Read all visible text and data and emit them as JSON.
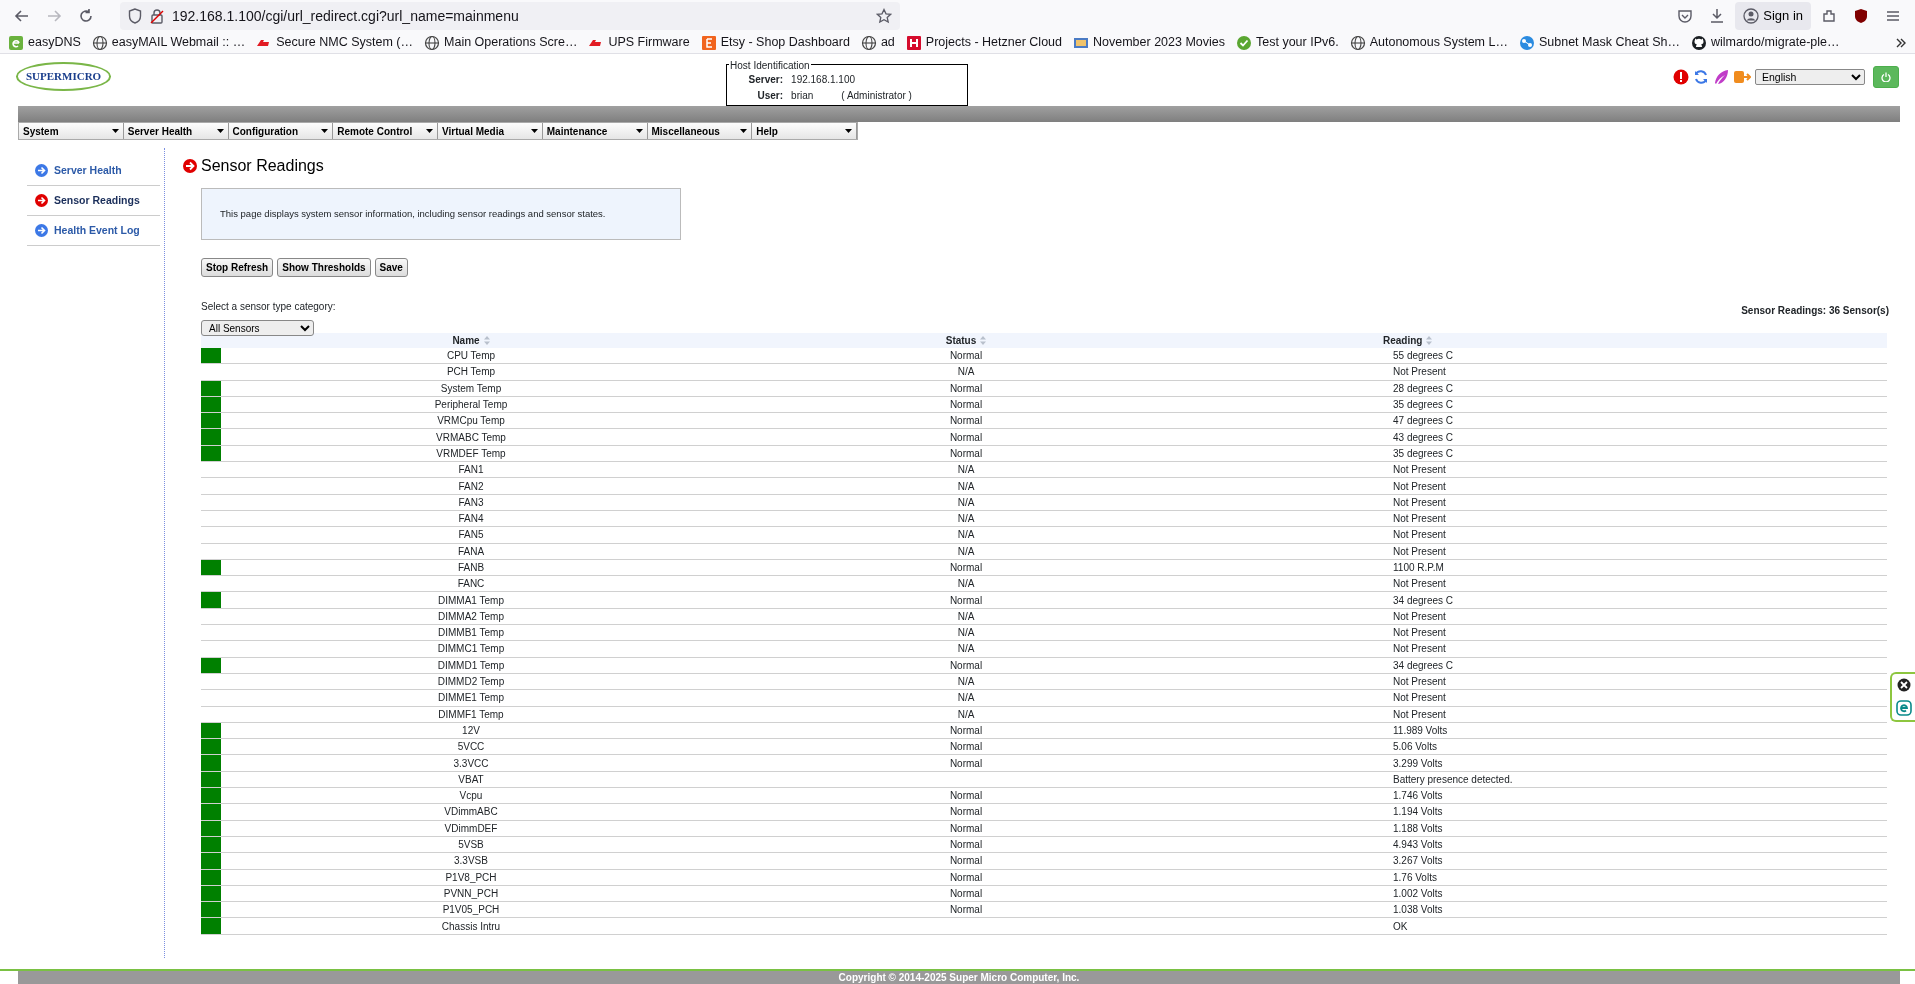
{
  "browser": {
    "url": "192.168.1.100/cgi/url_redirect.cgi?url_name=mainmenu",
    "sign_in": "Sign in",
    "bookmarks": [
      {
        "kind": "easydns",
        "label": "easyDNS"
      },
      {
        "kind": "globe",
        "label": "easyMAIL Webmail :: …"
      },
      {
        "kind": "apc",
        "label": "Secure NMC System (…"
      },
      {
        "kind": "globe",
        "label": "Main Operations Scre…"
      },
      {
        "kind": "apc",
        "label": "UPS Firmware"
      },
      {
        "kind": "etsy",
        "label": "Etsy - Shop Dashboard"
      },
      {
        "kind": "globe",
        "label": "ad"
      },
      {
        "kind": "hetzner",
        "label": "Projects - Hetzner Cloud"
      },
      {
        "kind": "film",
        "label": "November 2023 Movies"
      },
      {
        "kind": "check",
        "label": "Test your IPv6."
      },
      {
        "kind": "globe",
        "label": "Autonomous System L…"
      },
      {
        "kind": "subnet",
        "label": "Subnet Mask Cheat Sh…"
      },
      {
        "kind": "github",
        "label": "wilmardo/migrate-ple…"
      }
    ]
  },
  "header": {
    "logo": "SUPERMICRO",
    "host_legend": "Host Identification",
    "server_label": "Server:",
    "server": "192.168.1.100",
    "user_label": "User:",
    "user": "brian",
    "role": "( Administrator )",
    "language": "English"
  },
  "menu": [
    "System",
    "Server Health",
    "Configuration",
    "Remote Control",
    "Virtual Media",
    "Maintenance",
    "Miscellaneous",
    "Help"
  ],
  "sidebar": {
    "items": [
      {
        "label": "Server Health",
        "selected": false
      },
      {
        "label": "Sensor Readings",
        "selected": true
      },
      {
        "label": "Health Event Log",
        "selected": false
      }
    ]
  },
  "page": {
    "title": "Sensor Readings",
    "intro": "This page displays system sensor information, including sensor readings and sensor states.",
    "buttons": [
      "Stop Refresh",
      "Show Thresholds",
      "Save"
    ],
    "category_label": "Select a sensor type category:",
    "category": "All Sensors",
    "count": "Sensor Readings: 36 Sensor(s)"
  },
  "table": {
    "columns": [
      "Name",
      "Status",
      "Reading"
    ],
    "rows": [
      {
        "name": "CPU Temp",
        "status": "Normal",
        "reading": "55 degrees C",
        "lit": true
      },
      {
        "name": "PCH Temp",
        "status": "N/A",
        "reading": "Not Present",
        "lit": false
      },
      {
        "name": "System Temp",
        "status": "Normal",
        "reading": "28 degrees C",
        "lit": true
      },
      {
        "name": "Peripheral Temp",
        "status": "Normal",
        "reading": "35 degrees C",
        "lit": true
      },
      {
        "name": "VRMCpu Temp",
        "status": "Normal",
        "reading": "47 degrees C",
        "lit": true
      },
      {
        "name": "VRMABC Temp",
        "status": "Normal",
        "reading": "43 degrees C",
        "lit": true
      },
      {
        "name": "VRMDEF Temp",
        "status": "Normal",
        "reading": "35 degrees C",
        "lit": true
      },
      {
        "name": "FAN1",
        "status": "N/A",
        "reading": "Not Present",
        "lit": false
      },
      {
        "name": "FAN2",
        "status": "N/A",
        "reading": "Not Present",
        "lit": false
      },
      {
        "name": "FAN3",
        "status": "N/A",
        "reading": "Not Present",
        "lit": false
      },
      {
        "name": "FAN4",
        "status": "N/A",
        "reading": "Not Present",
        "lit": false
      },
      {
        "name": "FAN5",
        "status": "N/A",
        "reading": "Not Present",
        "lit": false
      },
      {
        "name": "FANA",
        "status": "N/A",
        "reading": "Not Present",
        "lit": false
      },
      {
        "name": "FANB",
        "status": "Normal",
        "reading": "1100 R.P.M",
        "lit": true
      },
      {
        "name": "FANC",
        "status": "N/A",
        "reading": "Not Present",
        "lit": false
      },
      {
        "name": "DIMMA1 Temp",
        "status": "Normal",
        "reading": "34 degrees C",
        "lit": true
      },
      {
        "name": "DIMMA2 Temp",
        "status": "N/A",
        "reading": "Not Present",
        "lit": false
      },
      {
        "name": "DIMMB1 Temp",
        "status": "N/A",
        "reading": "Not Present",
        "lit": false
      },
      {
        "name": "DIMMC1 Temp",
        "status": "N/A",
        "reading": "Not Present",
        "lit": false
      },
      {
        "name": "DIMMD1 Temp",
        "status": "Normal",
        "reading": "34 degrees C",
        "lit": true
      },
      {
        "name": "DIMMD2 Temp",
        "status": "N/A",
        "reading": "Not Present",
        "lit": false
      },
      {
        "name": "DIMME1 Temp",
        "status": "N/A",
        "reading": "Not Present",
        "lit": false
      },
      {
        "name": "DIMMF1 Temp",
        "status": "N/A",
        "reading": "Not Present",
        "lit": false
      },
      {
        "name": "12V",
        "status": "Normal",
        "reading": "11.989 Volts",
        "lit": true
      },
      {
        "name": "5VCC",
        "status": "Normal",
        "reading": "5.06 Volts",
        "lit": true
      },
      {
        "name": "3.3VCC",
        "status": "Normal",
        "reading": "3.299 Volts",
        "lit": true
      },
      {
        "name": "VBAT",
        "reading": "Battery presence detected.",
        "lit": true
      },
      {
        "name": "Vcpu",
        "status": "Normal",
        "reading": "1.746 Volts",
        "lit": true
      },
      {
        "name": "VDimmABC",
        "status": "Normal",
        "reading": "1.194 Volts",
        "lit": true
      },
      {
        "name": "VDimmDEF",
        "status": "Normal",
        "reading": "1.188 Volts",
        "lit": true
      },
      {
        "name": "5VSB",
        "status": "Normal",
        "reading": "4.943 Volts",
        "lit": true
      },
      {
        "name": "3.3VSB",
        "status": "Normal",
        "reading": "3.267 Volts",
        "lit": true
      },
      {
        "name": "P1V8_PCH",
        "status": "Normal",
        "reading": "1.76 Volts",
        "lit": true
      },
      {
        "name": "PVNN_PCH",
        "status": "Normal",
        "reading": "1.002 Volts",
        "lit": true
      },
      {
        "name": "P1V05_PCH",
        "status": "Normal",
        "reading": "1.038 Volts",
        "lit": true
      },
      {
        "name": "Chassis Intru",
        "reading": "OK",
        "lit": true
      }
    ]
  },
  "footer": "Copyright © 2014-2025 Super Micro Computer, Inc."
}
